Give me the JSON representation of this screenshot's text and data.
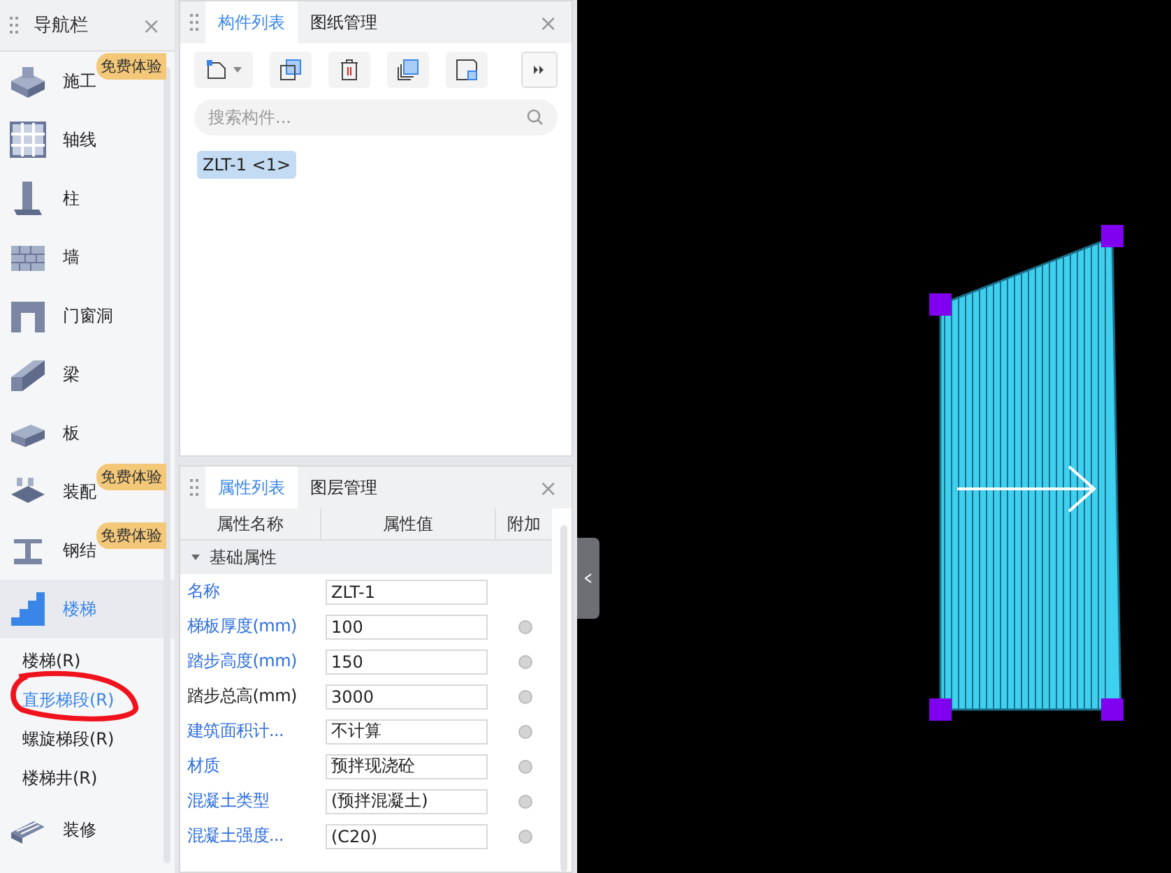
{
  "nav": {
    "title": "导航栏",
    "close": "×",
    "items": [
      {
        "label": "施工",
        "kind": "block",
        "badge": "免费体验",
        "selected": false
      },
      {
        "label": "轴线",
        "kind": "grid",
        "selected": false
      },
      {
        "label": "柱",
        "kind": "column",
        "selected": false
      },
      {
        "label": "墙",
        "kind": "wall",
        "selected": false
      },
      {
        "label": "门窗洞",
        "kind": "door",
        "selected": false
      },
      {
        "label": "梁",
        "kind": "beam",
        "selected": false
      },
      {
        "label": "板",
        "kind": "slab",
        "selected": false
      },
      {
        "label": "装配",
        "kind": "assembly",
        "badge": "免费体验",
        "selected": false
      },
      {
        "label": "钢结",
        "kind": "steel",
        "badge": "免费体验",
        "selected": false
      },
      {
        "label": "楼梯",
        "kind": "stair",
        "selected": true,
        "expanded": true,
        "children": [
          {
            "label": "楼梯(R)",
            "selected": false,
            "circled": false
          },
          {
            "label": "直形梯段(R)",
            "selected": true,
            "circled": true
          },
          {
            "label": "螺旋梯段(R)",
            "selected": false,
            "circled": false
          },
          {
            "label": "楼梯井(R)",
            "selected": false,
            "circled": false
          }
        ]
      },
      {
        "label": "装修",
        "kind": "decor",
        "selected": false
      }
    ]
  },
  "component_panel": {
    "tabs": [
      {
        "label": "构件列表",
        "selected": true
      },
      {
        "label": "图纸管理",
        "selected": false
      }
    ],
    "close": "×",
    "search": {
      "placeholder": "搜索构件..."
    },
    "items": [
      {
        "label": "ZLT-1 <1>",
        "selected": true
      }
    ]
  },
  "property_panel": {
    "tabs": [
      {
        "label": "属性列表",
        "selected": true
      },
      {
        "label": "图层管理",
        "selected": false
      }
    ],
    "close": "×",
    "columns": [
      "属性名称",
      "属性值",
      "附加"
    ],
    "group": {
      "label": "基础属性",
      "expanded": true
    },
    "rows": [
      {
        "name": "名称",
        "value": "ZLT-1",
        "kind": "public",
        "attach": false
      },
      {
        "name": "梯板厚度(mm)",
        "value": "100",
        "kind": "public",
        "attach": true
      },
      {
        "name": "踏步高度(mm)",
        "value": "150",
        "kind": "public",
        "attach": true
      },
      {
        "name": "踏步总高(mm)",
        "value": "3000",
        "kind": "private",
        "attach": true
      },
      {
        "name": "建筑面积计...",
        "value": "不计算",
        "kind": "public",
        "attach": true
      },
      {
        "name": "材质",
        "value": "预拌现浇砼",
        "kind": "public",
        "attach": true
      },
      {
        "name": "混凝土类型",
        "value": "(预拌混凝土)",
        "kind": "public",
        "attach": true
      },
      {
        "name": "混凝土强度...",
        "value": "(C20)",
        "kind": "public",
        "attach": true
      }
    ]
  }
}
